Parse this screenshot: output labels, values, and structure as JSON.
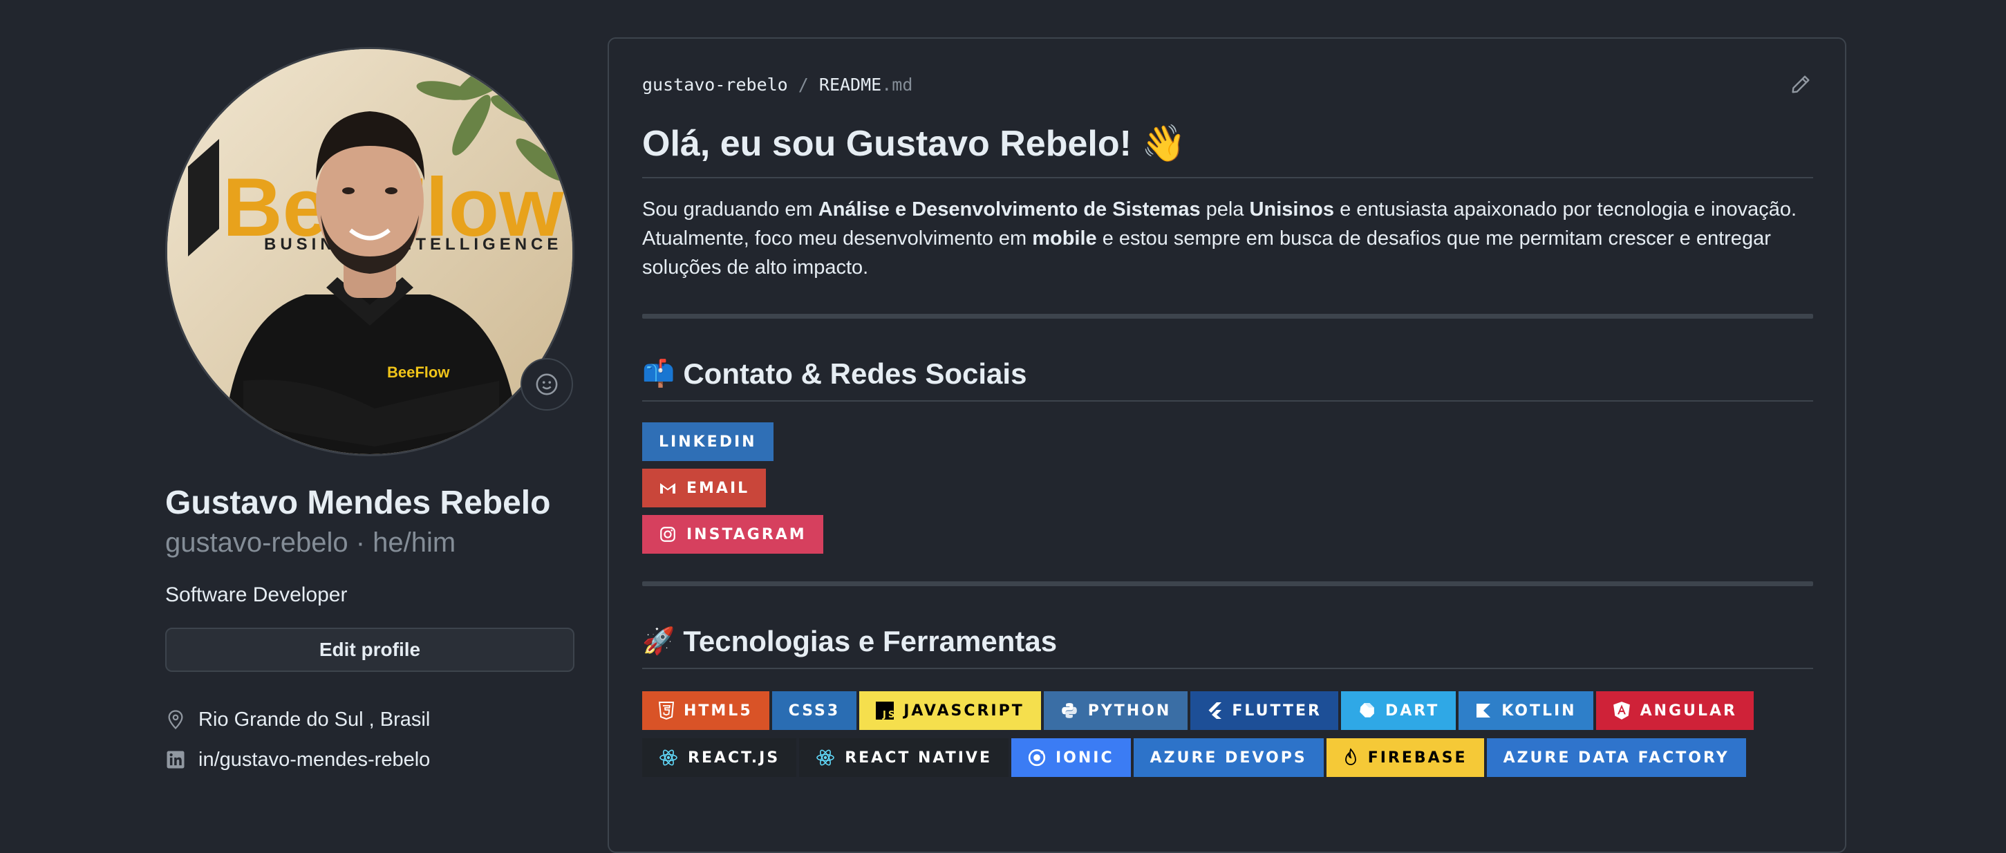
{
  "profile": {
    "full_name": "Gustavo Mendes Rebelo",
    "login_pronouns": "gustavo-rebelo · he/him",
    "bio": "Software Developer",
    "edit_label": "Edit profile",
    "location": "Rio Grande do Sul , Brasil",
    "linkedin": "in/gustavo-mendes-rebelo",
    "avatar_shirt_text": "BeeFlow",
    "avatar_wall_logo": "BeeFlow",
    "avatar_wall_tagline": "BUSINESS INTELLIGENCE"
  },
  "readme": {
    "path_user": "gustavo-rebelo",
    "path_sep": "/",
    "path_file": "README",
    "path_ext": ".md",
    "title": "Olá, eu sou Gustavo Rebelo! 👋",
    "intro": {
      "t1": "Sou graduando em ",
      "b1": "Análise e Desenvolvimento de Sistemas",
      "t2": " pela ",
      "b2": "Unisinos",
      "t3": " e entusiasta apaixonado por tecnologia e inovação. Atualmente, foco meu desenvolvimento em ",
      "b3": "mobile",
      "t4": " e estou sempre em busca de desafios que me permitam crescer e entregar soluções de alto impacto."
    },
    "contact": {
      "emoji": "📫",
      "heading": "Contato & Redes Sociais",
      "badges": [
        {
          "label": "LINKEDIN",
          "color": "#2f6fb6",
          "icon": "none"
        },
        {
          "label": "EMAIL",
          "color": "#c9463a",
          "icon": "gmail-icon"
        },
        {
          "label": "INSTAGRAM",
          "color": "#d6405e",
          "icon": "instagram-icon"
        }
      ]
    },
    "tech": {
      "emoji": "🚀",
      "heading": "Tecnologias e Ferramentas",
      "badges": [
        {
          "label": "HTML5",
          "color": "#d95327",
          "text_color": "#ffffff",
          "icon": "html5-icon"
        },
        {
          "label": "CSS3",
          "color": "#2a6db3",
          "text_color": "#ffffff",
          "icon": "none"
        },
        {
          "label": "JAVASCRIPT",
          "color": "#f5df4d",
          "text_color": "#000000",
          "icon": "js-icon"
        },
        {
          "label": "PYTHON",
          "color": "#3a6ea5",
          "text_color": "#ffffff",
          "icon": "python-icon"
        },
        {
          "label": "FLUTTER",
          "color": "#1d4f97",
          "text_color": "#ffffff",
          "icon": "flutter-icon"
        },
        {
          "label": "DART",
          "color": "#2fa8e6",
          "text_color": "#ffffff",
          "icon": "dart-icon"
        },
        {
          "label": "KOTLIN",
          "color": "#2e7fc9",
          "text_color": "#ffffff",
          "icon": "kotlin-icon"
        },
        {
          "label": "ANGULAR",
          "color": "#cf2238",
          "text_color": "#ffffff",
          "icon": "angular-icon"
        },
        {
          "label": "REACT.JS",
          "color": "#1f2328",
          "text_color": "#ffffff",
          "icon": "react-icon"
        },
        {
          "label": "REACT NATIVE",
          "color": "#1f2328",
          "text_color": "#ffffff",
          "icon": "react-icon"
        },
        {
          "label": "IONIC",
          "color": "#3b7cf4",
          "text_color": "#ffffff",
          "icon": "ionic-icon"
        },
        {
          "label": "AZURE DEVOPS",
          "color": "#2d73c9",
          "text_color": "#ffffff",
          "icon": "none"
        },
        {
          "label": "FIREBASE",
          "color": "#f5c937",
          "text_color": "#000000",
          "icon": "firebase-icon"
        },
        {
          "label": "AZURE DATA FACTORY",
          "color": "#2f74cc",
          "text_color": "#ffffff",
          "icon": "none"
        }
      ]
    }
  }
}
